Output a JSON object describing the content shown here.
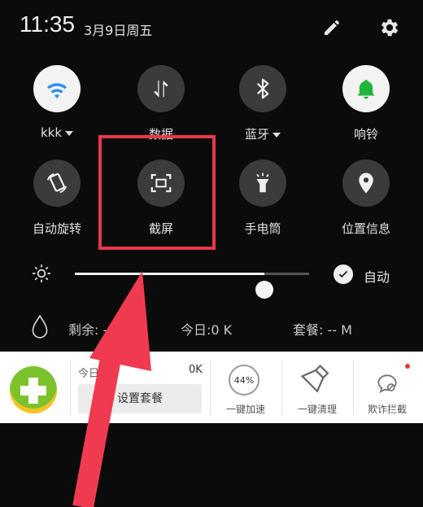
{
  "status_bar": {
    "time": "11:35",
    "date": "3月9日周五"
  },
  "quick_tiles": [
    {
      "label": "kkk",
      "icon": "wifi-icon"
    },
    {
      "label": "数据",
      "icon": "mobile-data-icon"
    },
    {
      "label": "蓝牙",
      "icon": "bluetooth-icon"
    },
    {
      "label": "响铃",
      "icon": "bell-icon"
    },
    {
      "label": "自动旋转",
      "icon": "auto-rotate-icon"
    },
    {
      "label": "截屏",
      "icon": "screenshot-icon"
    },
    {
      "label": "手电筒",
      "icon": "flashlight-icon"
    },
    {
      "label": "位置信息",
      "icon": "location-icon"
    }
  ],
  "brightness": {
    "auto_label": "自动",
    "level": 0.81
  },
  "data_usage": {
    "remaining": "剩余: -- M",
    "today": "今日:0 K",
    "package": "套餐: -- M"
  },
  "widget": {
    "today_label": "今日已",
    "today_value": "0K",
    "set_package_label": "设置套餐",
    "boost_percent": "44%",
    "boost_label": "一键加速",
    "clean_label": "一键清理",
    "fraud_label": "欺诈拦截"
  },
  "colors": {
    "highlight": "#e8384a",
    "bell_green": "#1fb53a",
    "wifi_blue": "#2f8ff0",
    "arrow": "#f03a50"
  }
}
